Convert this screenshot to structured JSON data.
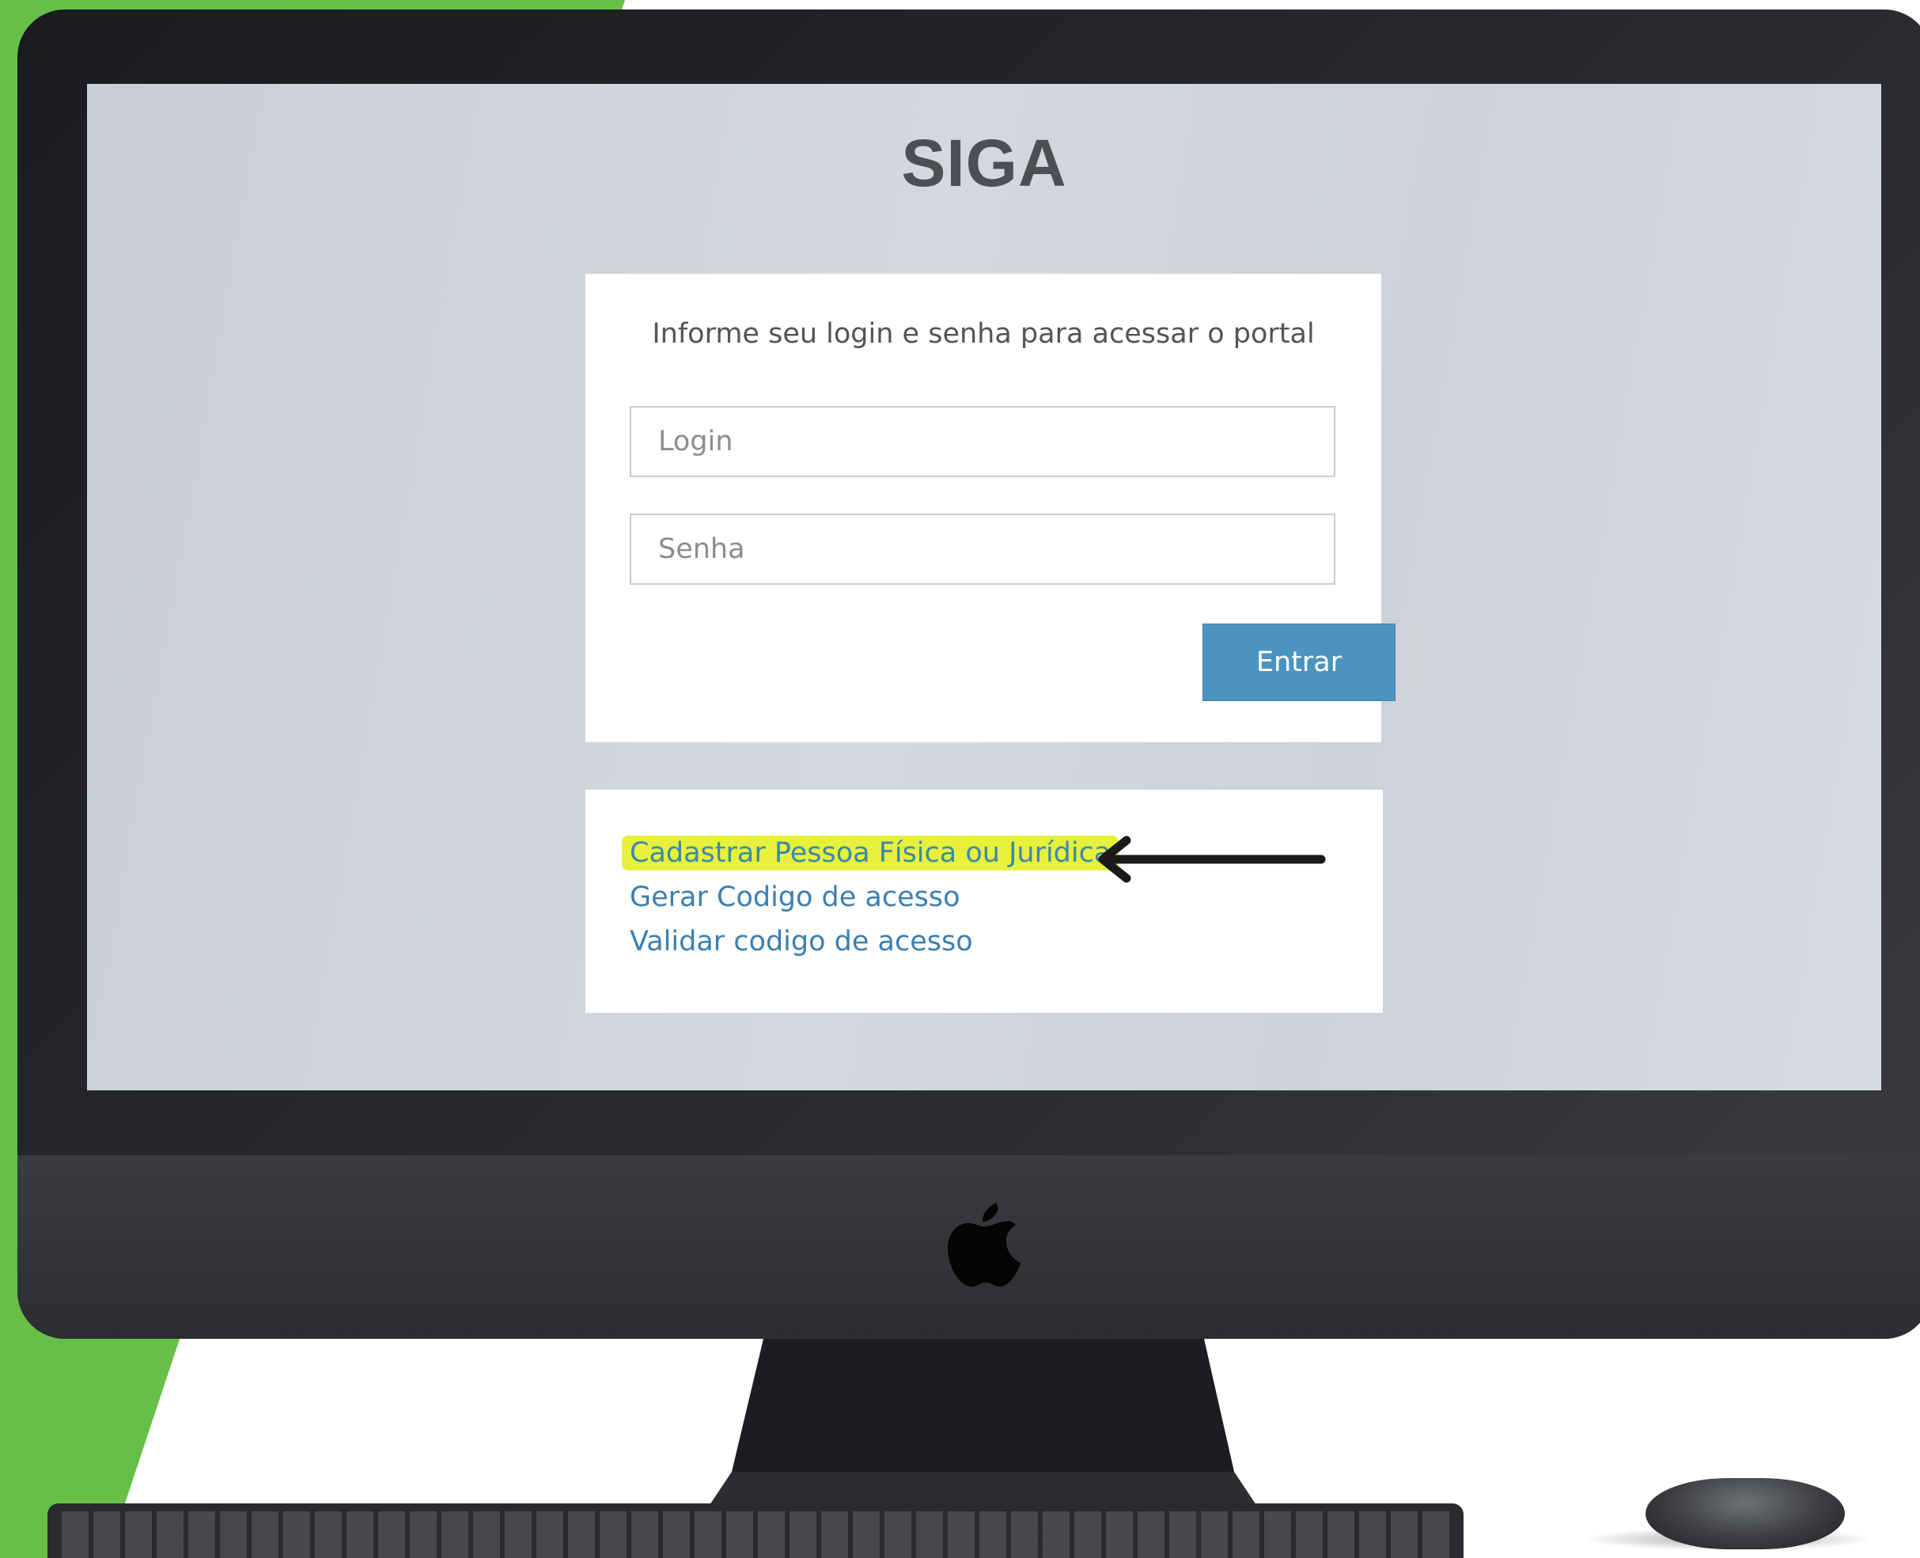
{
  "screen": {
    "app_title": "SIGA",
    "login_card": {
      "instruction": "Informe seu login e senha para acessar o portal",
      "login_placeholder": "Login",
      "password_placeholder": "Senha",
      "enter_label": "Entrar"
    },
    "links": {
      "register": "Cadastrar Pessoa Física ou Jurídica",
      "generate_code": "Gerar Codigo de acesso",
      "validate_code": "Validar codigo de acesso"
    }
  },
  "colors": {
    "accent_button": "#4b94c0",
    "link": "#3c7fb0",
    "highlight": "#e7f03b",
    "background_band": "#67bf4a"
  },
  "icons": {
    "brand": "apple-logo-icon",
    "annotation": "left-arrow-icon"
  }
}
